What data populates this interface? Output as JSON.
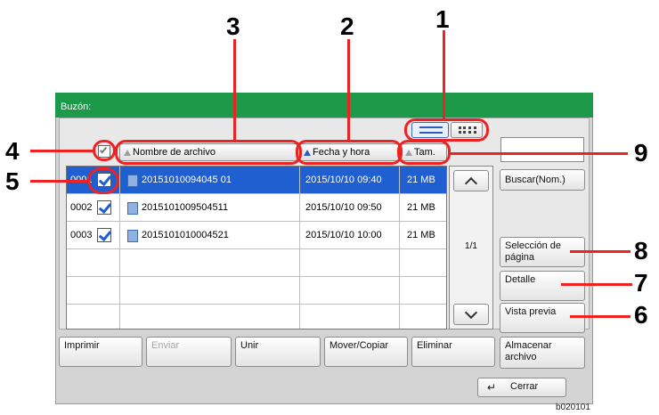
{
  "callouts": [
    "1",
    "2",
    "3",
    "4",
    "5",
    "6",
    "7",
    "8",
    "9"
  ],
  "window": {
    "title": "Buzón:"
  },
  "columns": {
    "name": "Nombre de archivo",
    "date": "Fecha y hora",
    "size": "Tam."
  },
  "rows": [
    {
      "num": "0001",
      "name": "20151010094045 01",
      "date": "2015/10/10 09:40",
      "size": "21 MB",
      "selected": true
    },
    {
      "num": "0002",
      "name": "2015101009504511",
      "date": "2015/10/10 09:50",
      "size": "21 MB",
      "selected": false
    },
    {
      "num": "0003",
      "name": "2015101010004521",
      "date": "2015/10/10 10:00",
      "size": "21 MB",
      "selected": false
    }
  ],
  "pager": "1/1",
  "side": {
    "search": "Buscar(Nom.)",
    "page_select": "Selección de página",
    "detail": "Detalle",
    "preview": "Vista previa"
  },
  "bottom": {
    "print": "Imprimir",
    "send": "Enviar",
    "merge": "Unir",
    "move_copy": "Mover/Copiar",
    "delete": "Eliminar",
    "store": "Almacenar archivo"
  },
  "close": "Cerrar",
  "code": "b020101",
  "colors": {
    "titlebar": "#1c9a4a",
    "selection": "#1f5fd0",
    "callout_line": "#ee2222"
  }
}
